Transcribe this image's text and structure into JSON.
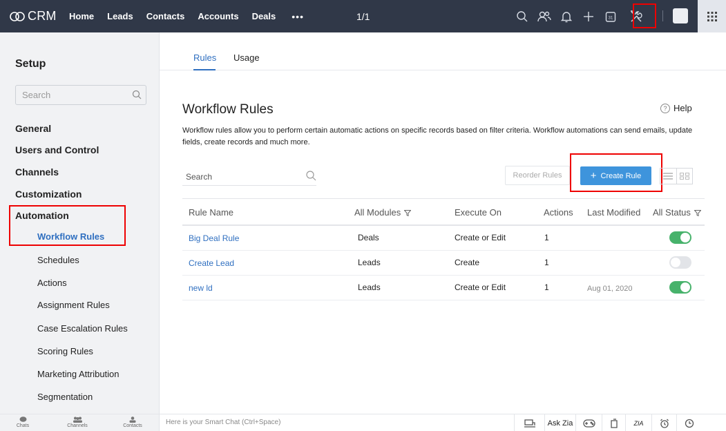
{
  "topbar": {
    "brand": "CRM",
    "nav": [
      "Home",
      "Leads",
      "Contacts",
      "Accounts",
      "Deals"
    ],
    "more": "•••",
    "pager": "1/1",
    "icons": [
      "search-icon",
      "contacts-icon",
      "bell-icon",
      "plus-icon",
      "calendar-icon",
      "setup-tools-icon",
      "avatar",
      "apps-grid-icon"
    ],
    "calendar_day": "31"
  },
  "sidebar": {
    "title": "Setup",
    "search_placeholder": "Search",
    "categories": [
      "General",
      "Users and Control",
      "Channels",
      "Customization",
      "Automation"
    ],
    "automation_items": [
      "Workflow Rules",
      "Schedules",
      "Actions",
      "Assignment Rules",
      "Case Escalation Rules",
      "Scoring Rules",
      "Marketing Attribution",
      "Segmentation"
    ],
    "active_item": "Workflow Rules"
  },
  "tabs": [
    "Rules",
    "Usage"
  ],
  "main": {
    "title": "Workflow Rules",
    "help": "Help",
    "description": "Workflow rules allow you to perform certain automatic actions on specific records based on filter criteria. Workflow automations can send emails, update fields, create records and much more.",
    "search_placeholder": "Search",
    "reorder_label": "Reorder Rules",
    "create_label": "Create Rule",
    "create_plus": "+"
  },
  "table": {
    "headers": [
      "Rule Name",
      "All Modules",
      "Execute On",
      "Actions",
      "Last Modified",
      "All Status"
    ],
    "rows": [
      {
        "name": "Big Deal Rule",
        "module": "Deals",
        "execute": "Create or Edit",
        "actions": "1",
        "modified": "",
        "status": true
      },
      {
        "name": "Create Lead",
        "module": "Leads",
        "execute": "Create",
        "actions": "1",
        "modified": "",
        "status": false
      },
      {
        "name": "new ld",
        "module": "Leads",
        "execute": "Create or Edit",
        "actions": "1",
        "modified": "Aug 01, 2020",
        "status": true
      }
    ]
  },
  "bottombar": {
    "left_items": [
      "Chats",
      "Channels",
      "Contacts"
    ],
    "smartchat": "Here is your Smart Chat (Ctrl+Space)",
    "ask_zia": "Ask Zia",
    "zia_short": "ZIA"
  },
  "colors": {
    "topbar": "#303848",
    "link": "#2f6fc0",
    "primary_button": "#3e94dc",
    "toggle_on": "#47b26b",
    "highlight": "#ee0000"
  }
}
